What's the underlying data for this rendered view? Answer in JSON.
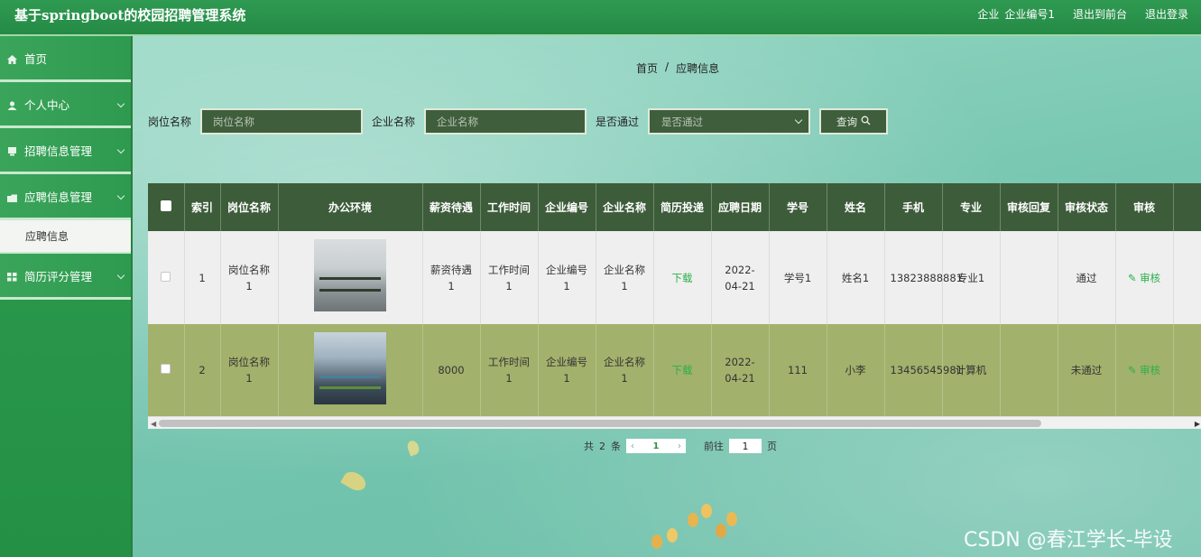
{
  "header": {
    "title": "基于springboot的校园招聘管理系统",
    "user_role": "企业",
    "user_name": "企业编号1",
    "back_front": "退出到前台",
    "logout": "退出登录"
  },
  "sidebar": {
    "items": [
      {
        "label": "首页",
        "icon": "home-icon"
      },
      {
        "label": "个人中心",
        "icon": "user-icon"
      },
      {
        "label": "招聘信息管理",
        "icon": "document-icon"
      },
      {
        "label": "应聘信息管理",
        "icon": "folder-icon"
      },
      {
        "label": "应聘信息",
        "icon": ""
      },
      {
        "label": "简历评分管理",
        "icon": "grid-icon"
      }
    ]
  },
  "breadcrumb": {
    "home": "首页",
    "sep": "/",
    "current": "应聘信息"
  },
  "search": {
    "job_label": "岗位名称",
    "job_placeholder": "岗位名称",
    "company_label": "企业名称",
    "company_placeholder": "企业名称",
    "pass_label": "是否通过",
    "pass_placeholder": "是否通过",
    "query_button": "查询"
  },
  "table": {
    "headers": [
      "索引",
      "岗位名称",
      "办公环境",
      "薪资待遇",
      "工作时间",
      "企业编号",
      "企业名称",
      "简历投递",
      "应聘日期",
      "学号",
      "姓名",
      "手机",
      "专业",
      "审核回复",
      "审核状态",
      "审核"
    ],
    "rows": [
      {
        "index": "1",
        "job": "岗位名称1",
        "salary": "薪资待遇1",
        "time": "工作时间1",
        "company_no": "企业编号1",
        "company_name": "企业名称1",
        "resume": "下载",
        "date": "2022-04-21",
        "student_no": "学号1",
        "name": "姓名1",
        "phone": "13823888881",
        "major": "专业1",
        "reply": "",
        "status": "通过",
        "audit": "审核"
      },
      {
        "index": "2",
        "job": "岗位名称1",
        "salary": "8000",
        "time": "工作时间1",
        "company_no": "企业编号1",
        "company_name": "企业名称1",
        "resume": "下载",
        "date": "2022-04-21",
        "student_no": "111",
        "name": "小李",
        "phone": "13456545981",
        "major": "计算机",
        "reply": "",
        "status": "未通过",
        "audit": "审核"
      }
    ]
  },
  "pagination": {
    "total_prefix": "共",
    "total": "2",
    "total_suffix": "条",
    "current_page": "1",
    "goto_label": "前往",
    "goto_value": "1",
    "goto_suffix": "页"
  },
  "watermark": "CSDN @春江学长-毕设",
  "colors": {
    "header_green": "#2f9a52",
    "input_dark": "#3f5e3c",
    "row_highlight": "#a2b16c",
    "link_green": "#2bb04a"
  }
}
